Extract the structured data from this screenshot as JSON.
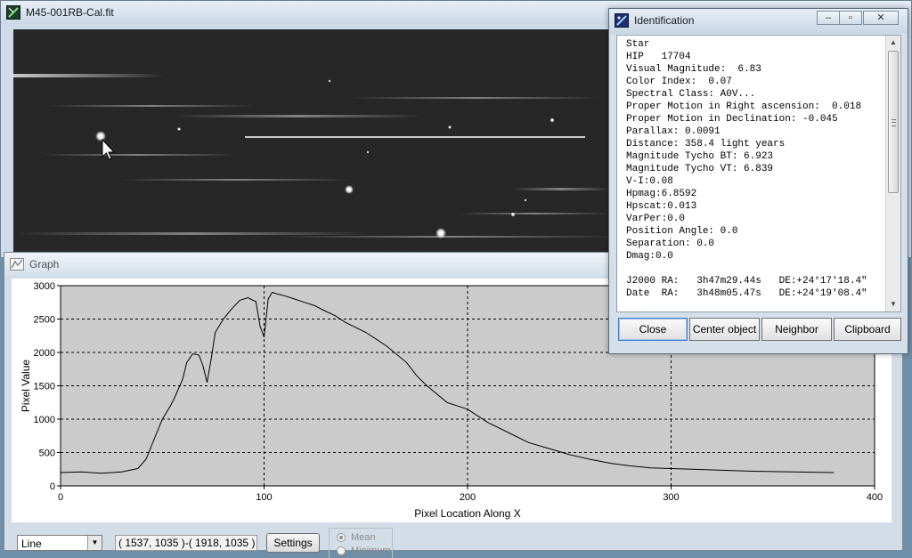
{
  "image_window": {
    "title": "M45-001RB-Cal.fit",
    "icon": "fits-image-icon"
  },
  "graph_window": {
    "title": "Graph",
    "icon": "graph-icon",
    "mode_select": {
      "selected": "Line"
    },
    "line_coords": "( 1537, 1035 )-( 1918, 1035 )",
    "settings_label": "Settings",
    "radio_options": [
      {
        "label": "Mean",
        "selected": true
      },
      {
        "label": "Minimum",
        "selected": false
      }
    ]
  },
  "identification": {
    "title": "Identification",
    "icon": "identify-icon",
    "lines": [
      "Star",
      "HIP   17704",
      "Visual Magnitude:  6.83",
      "Color Index:  0.07",
      "Spectral Class: A0V...",
      "Proper Motion in Right ascension:  0.018",
      "Proper Motion in Declination: -0.045",
      "Parallax: 0.0091",
      "Distance: 358.4 light years",
      "Magnitude Tycho BT: 6.923",
      "Magnitude Tycho VT: 6.839",
      "V-I:0.08",
      "Hpmag:6.8592",
      "Hpscat:0.013",
      "VarPer:0.0",
      "Position Angle: 0.0",
      "Separation: 0.0",
      "Dmag:0.0",
      "",
      "J2000 RA:   3h47m29.44s   DE:+24°17'18.4\"",
      "Date  RA:   3h48m05.47s   DE:+24°19'08.4\""
    ],
    "buttons": [
      "Close",
      "Center object",
      "Neighbor",
      "Clipboard"
    ]
  },
  "chart_data": {
    "type": "line",
    "title": "",
    "xlabel": "Pixel Location Along X",
    "ylabel": "Pixel Value",
    "xlim": [
      0,
      400
    ],
    "ylim": [
      0,
      3000
    ],
    "xticks": [
      0,
      100,
      200,
      300,
      400
    ],
    "yticks": [
      0,
      500,
      1000,
      1500,
      2000,
      2500,
      3000
    ],
    "grid": true,
    "series": [
      {
        "x": [
          0,
          10,
          20,
          30,
          38,
          42,
          46,
          50,
          54,
          56,
          60,
          62,
          65,
          68,
          70,
          72,
          74,
          76,
          80,
          84,
          88,
          92,
          96,
          98,
          100,
          102,
          104,
          106,
          110,
          115,
          120,
          125,
          130,
          135,
          140,
          150,
          160,
          170,
          175,
          180,
          190,
          200,
          210,
          220,
          230,
          240,
          250,
          260,
          270,
          280,
          290,
          300,
          320,
          340,
          360,
          380
        ],
        "y": [
          200,
          210,
          190,
          210,
          260,
          400,
          700,
          1000,
          1200,
          1320,
          1600,
          1850,
          1980,
          1960,
          1800,
          1550,
          1900,
          2300,
          2500,
          2650,
          2780,
          2820,
          2760,
          2400,
          2230,
          2800,
          2900,
          2880,
          2850,
          2800,
          2750,
          2700,
          2620,
          2550,
          2450,
          2300,
          2100,
          1850,
          1650,
          1500,
          1250,
          1150,
          950,
          800,
          650,
          560,
          470,
          400,
          340,
          300,
          270,
          260,
          240,
          220,
          210,
          200
        ]
      }
    ]
  }
}
